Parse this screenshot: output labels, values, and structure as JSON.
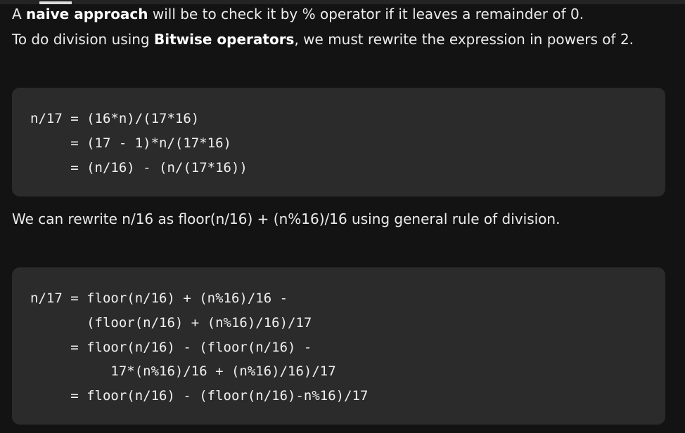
{
  "intro": {
    "line1": {
      "prefix": "A ",
      "bold": "naive approach",
      "suffix": " will be to check it by % operator if it leaves a remainder of 0."
    },
    "line2": {
      "prefix": "To do division using ",
      "bold": "Bitwise operators",
      "suffix": ", we must rewrite the expression in powers of 2."
    }
  },
  "code_block_1": {
    "lines": [
      "n/17 = (16*n)/(17*16)",
      "     = (17 - 1)*n/(17*16)",
      "     = (n/16) - (n/(17*16))"
    ]
  },
  "middle_text": "We can rewrite n/16 as floor(n/16) + (n%16)/16 using general rule of division.",
  "code_block_2": {
    "lines": [
      "n/17 = floor(n/16) + (n%16)/16 -",
      "       (floor(n/16) + (n%16)/16)/17",
      "     = floor(n/16) - (floor(n/16) -",
      "          17*(n%16)/16 + (n%16)/16)/17",
      "     = floor(n/16) - (floor(n/16)-n%16)/17"
    ]
  }
}
